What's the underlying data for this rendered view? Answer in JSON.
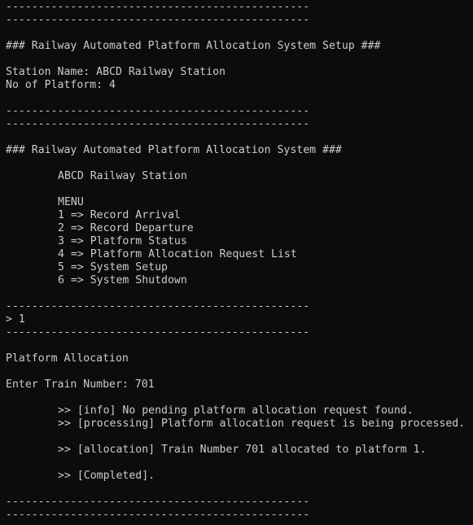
{
  "terminal": {
    "separator": "-----------------------------------------------",
    "setup_title": "### Railway Automated Platform Allocation System Setup ###",
    "station_name_line": "Station Name: ABCD Railway Station",
    "platform_count_line": "No of Platform: 4",
    "system_title": "### Railway Automated Platform Allocation System ###",
    "station_heading": "ABCD Railway Station",
    "menu_heading": "MENU",
    "menu_items": [
      "1 => Record Arrival",
      "2 => Record Departure",
      "3 => Platform Status",
      "4 => Platform Allocation Request List",
      "5 => System Setup",
      "6 => System Shutdown"
    ],
    "prompt_line": "> 1",
    "section_title": "Platform Allocation",
    "train_input_line": "Enter Train Number: 701",
    "messages": [
      ">> [info] No pending platform allocation request found.",
      ">> [processing] Platform allocation request is being processed.",
      ">> [allocation] Train Number 701 allocated to platform 1.",
      ">> [Completed]."
    ]
  }
}
